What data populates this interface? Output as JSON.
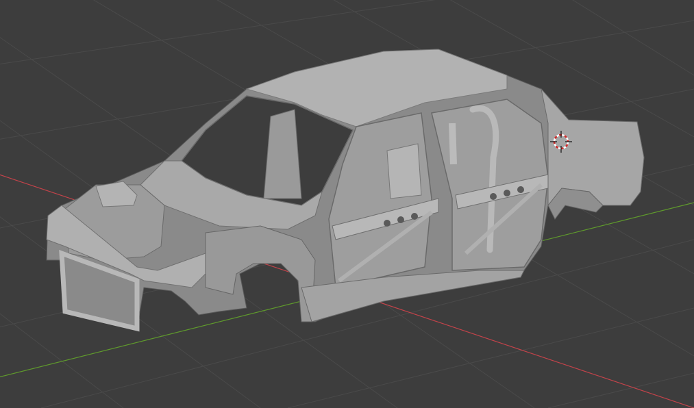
{
  "viewport": {
    "background_color": "#3d3d3d",
    "grid_color": "#4a4a4a",
    "x_axis_color": "#c3434a",
    "y_axis_color": "#5f9a2c",
    "object": {
      "name": "car-body-shell",
      "shading": "solid",
      "base_color": "#a8a8a8",
      "shadow_color": "#6f6f6f",
      "highlight_color": "#c4c4c4"
    },
    "cursor_3d": {
      "icon": "3d-cursor-icon",
      "ring_color_a": "#ffffff",
      "ring_color_b": "#d12a2a"
    }
  }
}
